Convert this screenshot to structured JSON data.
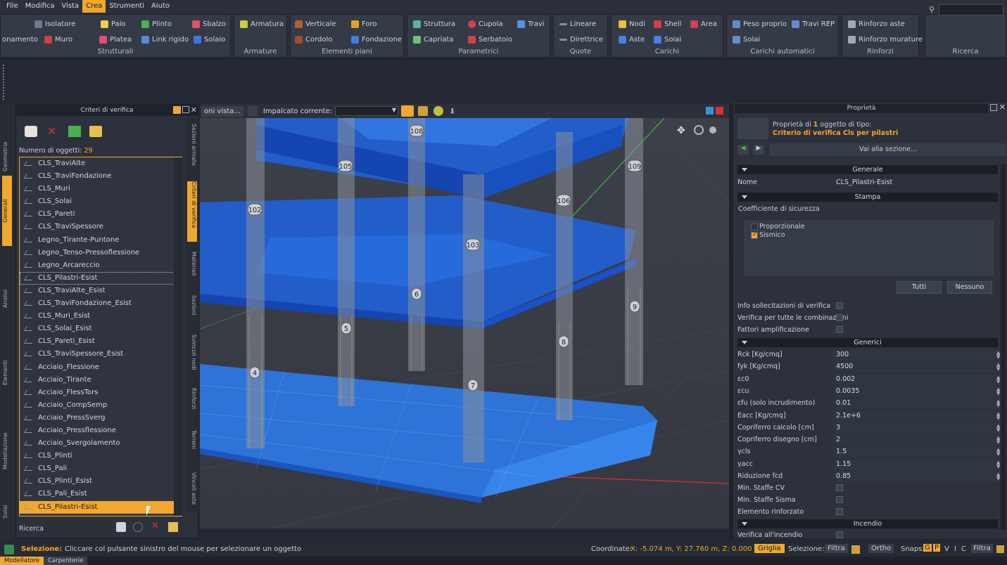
{
  "menu": [
    "File",
    "Modifica",
    "Vista",
    "Crea",
    "Strumenti",
    "Aiuto"
  ],
  "menu_active": "Crea",
  "ribbon": {
    "strutturali": {
      "label": "Strutturali",
      "items": [
        "Isolatore",
        "Palo",
        "Plinto",
        "Sbalzo",
        "onamento",
        "Muro",
        "Platea",
        "Link rigido",
        "Solaio"
      ]
    },
    "armature": {
      "label": "Armature",
      "items": [
        "Armatura"
      ]
    },
    "elementi_piani": {
      "label": "Elementi piani",
      "items": [
        "Verticale",
        "Foro",
        "Cordolo",
        "Fondazione"
      ]
    },
    "parametrici": {
      "label": "Parametrici",
      "items": [
        "Struttura",
        "Cupola",
        "Travi",
        "Capriata",
        "Serbatoio"
      ]
    },
    "quote": {
      "label": "Quote",
      "items": [
        "Lineare",
        "Direttrice"
      ]
    },
    "carichi": {
      "label": "Carichi",
      "items": [
        "Nodi",
        "Shell",
        "Area",
        "Aste",
        "Solai"
      ]
    },
    "carichi_automatici": {
      "label": "Carichi automatici",
      "items": [
        "Peso proprio",
        "Travi REP",
        "Solai"
      ]
    },
    "rinforzi": {
      "label": "Rinforzi",
      "items": [
        "Rinforzo aste",
        "Rinforzo murature"
      ]
    },
    "ricerca": {
      "label": "Ricerca"
    }
  },
  "left_tabs": [
    "Geometria",
    "Generali",
    "Analisi",
    "Elementi",
    "Modellazione",
    "Solai"
  ],
  "left_tab_active": "Generali",
  "criteria_panel": {
    "title": "Criteri di verifica",
    "count_label": "Numero di oggetti:",
    "count_value": "29",
    "items": [
      "CLS_TraviAlte",
      "CLS_TraviFondazione",
      "CLS_Muri",
      "CLS_Solai",
      "CLS_Pareti",
      "CLS_TraviSpessore",
      "Legno_Tirante-Puntone",
      "Legno_Tenso-Pressoflessione",
      "Legno_Arcareccio",
      "CLS_Pilastri-Esist",
      "CLS_TraviAlte_Esist",
      "CLS_TraviFondazione_Esist",
      "CLS_Muri_Esist",
      "CLS_Solai_Esist",
      "CLS_Pareti_Esist",
      "CLS_TraviSpessore_Esist",
      "Acciaio_Flessione",
      "Acciaio_Tirante",
      "Acciaio_FlessTors",
      "Acciaio_CompSemp",
      "Acciaio_PressSverg",
      "Acciaio_Pressflessione",
      "Acciaio_Svergolamento",
      "CLS_Plinti",
      "CLS_Pali",
      "CLS_Plinti_Esist",
      "CLS_Pali_Esist",
      "CLS_Pilastri-Esist"
    ],
    "selected_index": 27,
    "focused_index": 9,
    "search_label": "Ricerca:"
  },
  "mid_tabs": [
    "Sezioni armate",
    "Criteri di verifica",
    "Materiali",
    "Sezioni",
    "Svincoli nodi",
    "Rinforzi",
    "Terreni",
    "Vincoli aste"
  ],
  "mid_tab_active": "Criteri di verifica",
  "viewport_toolbar": {
    "left_text": "oni vista...",
    "impalcato_label": "Impalcato corrente:",
    "impalcato_value": ""
  },
  "node_labels": [
    "108",
    "105",
    "109",
    "102",
    "106",
    "103",
    "6",
    "9",
    "5",
    "8",
    "4",
    "7"
  ],
  "properties": {
    "title": "Proprietà",
    "header_line1_a": "Proprietà di ",
    "header_line1_b": "1",
    "header_line1_c": " oggetto di tipo:",
    "header_line2": "Criterio di verifica Cls per pilastri",
    "goto_section": "Vai alla sezione...",
    "sec_generale": "Generale",
    "nome_label": "Nome",
    "nome_value": "CLS_Pilastri-Esist",
    "sec_stampa": "Stampa",
    "coeff_label": "Coefficiente di sicurezza",
    "opt_proporzionale": "Proporzionale",
    "opt_sismico": "Sismico",
    "btn_tutti": "Tutti",
    "btn_nessuno": "Nessuno",
    "flags": [
      "Info sollecitazioni di verifica",
      "Verifica per tutte le combinazioni",
      "Fattori amplificazione"
    ],
    "sec_generici": "Generici",
    "generici": [
      {
        "label": "Rck [Kg/cmq]",
        "value": "300"
      },
      {
        "label": "fyk [Kg/cmq]",
        "value": "4500"
      },
      {
        "label": "εc0",
        "value": "0.002"
      },
      {
        "label": "εcu",
        "value": "0.0035"
      },
      {
        "label": "εfu (solo incrudimento)",
        "value": "0.01"
      },
      {
        "label": "Eacc [Kg/cmq]",
        "value": "2.1e+6"
      },
      {
        "label": "Copriferro calcolo [cm]",
        "value": "3"
      },
      {
        "label": "Copriferro disegno [cm]",
        "value": "2"
      },
      {
        "label": "γcls",
        "value": "1.5"
      },
      {
        "label": "γacc",
        "value": "1.15"
      },
      {
        "label": "Riduzione fcd",
        "value": "0.85"
      }
    ],
    "generici_flags": [
      "Min. Staffe CV",
      "Min. Staffe Sisma",
      "Elemento rinforzato"
    ],
    "sec_incendio": "Incendio",
    "incendio_first": "Verifica all'incendio"
  },
  "status": {
    "sel_label": "Selezione:",
    "sel_text": "Cliccare col pulsante sinistro del mouse per selezionare un oggetto",
    "coord_label": "Coordinate:",
    "coord_value": "X: -5.074 m, Y: 27.760 m, Z: 0.000 m",
    "griglia": "Griglia",
    "selezione": "Selezione:",
    "filtra": "Filtra",
    "ortho": "Ortho",
    "snaps": "Snaps:",
    "snap_keys": [
      "G",
      "P",
      "V",
      "I",
      "C"
    ],
    "filtra2": "Filtra"
  },
  "bottom_tabs": [
    "Modellatore",
    "Carpenterie"
  ],
  "colors": {
    "accent": "#f0a830",
    "slab": "#1f63e0",
    "column": "#9aa0ab"
  }
}
